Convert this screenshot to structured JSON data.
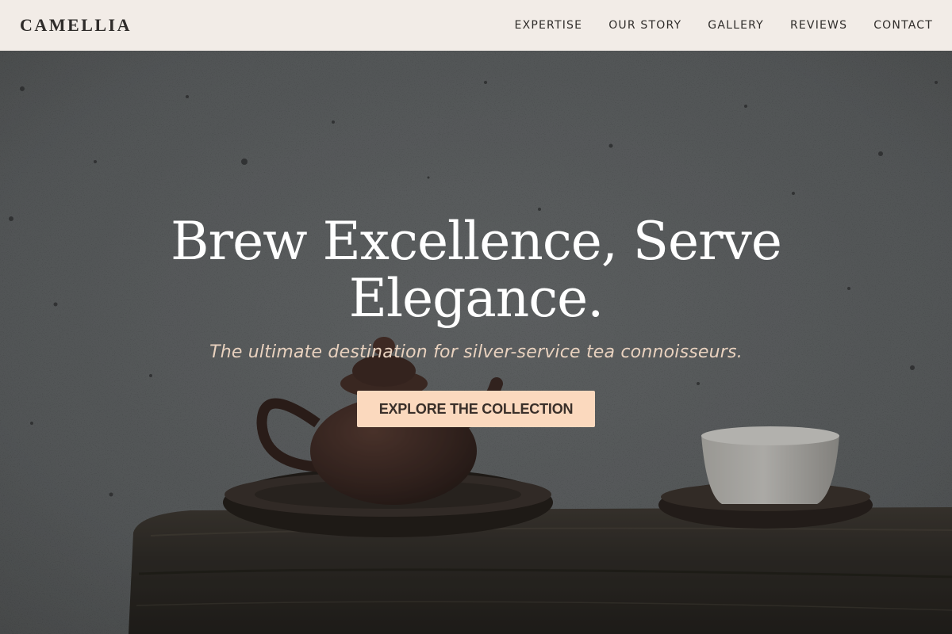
{
  "header": {
    "logo": "CAMELLIA",
    "nav": [
      {
        "label": "EXPERTISE"
      },
      {
        "label": "OUR STORY"
      },
      {
        "label": "GALLERY"
      },
      {
        "label": "REVIEWS"
      },
      {
        "label": "CONTACT"
      }
    ]
  },
  "hero": {
    "headline": "Brew Excellence, Serve Elegance.",
    "subheadline": "The ultimate destination for silver-service tea connoisseurs.",
    "cta_label": "EXPLORE THE COLLECTION"
  },
  "colors": {
    "header_bg": "#f2ece7",
    "cta_bg": "#fbd9be",
    "subheadline": "#e9d2bf",
    "headline": "#ffffff"
  }
}
